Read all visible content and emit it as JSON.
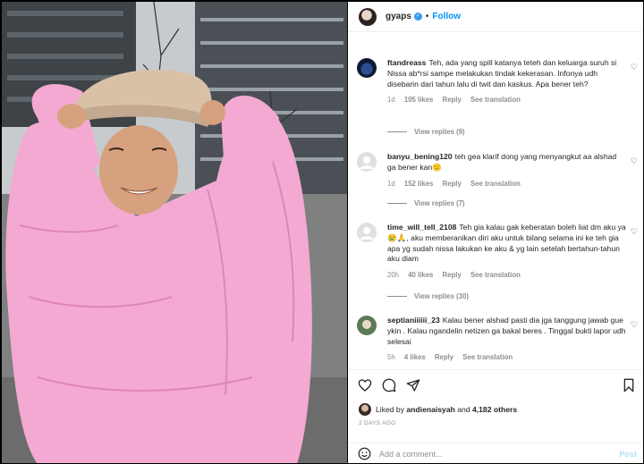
{
  "header": {
    "username": "gyaps",
    "separator": "•",
    "follow_label": "Follow"
  },
  "comments": [
    {
      "username": "ftandreass",
      "text": "Teh, ada yang spill katanya teteh dan keluarga suruh si Nissa ab*rsi sampe melakukan tindak kekerasan. Infonya udh disebarin dari tahun lalu di twit dan kaskus. Apa bener teh?",
      "time": "1d",
      "likes": "105 likes",
      "reply_label": "Reply",
      "translate_label": "See translation",
      "view_replies": "View replies (9)"
    },
    {
      "username": "banyu_bening120",
      "text": "teh gea klarif dong yang menyangkut aa alshad ga bener kan😕",
      "time": "1d",
      "likes": "152 likes",
      "reply_label": "Reply",
      "translate_label": "See translation",
      "view_replies": "View replies (7)"
    },
    {
      "username": "time_will_tell_2108",
      "text": "Teh gia kalau gak keberatan boleh liat dm aku ya 😢🙏, aku memberanikan diri aku untuk bilang selama ini ke teh gia apa yg sudah nissa lakukan ke aku & yg lain setelah bertahun-tahun aku diam",
      "time": "20h",
      "likes": "40 likes",
      "reply_label": "Reply",
      "translate_label": "See translation",
      "view_replies": "View replies (30)"
    },
    {
      "username": "septianiiiiii_23",
      "text": "Kalau bener alshad pasti dia jga tanggung jawab gue ykin . Kalau ngandelin netizen ga bakal beres . Tinggal bukti lapor udh selesai",
      "time": "5h",
      "likes": "4 likes",
      "reply_label": "Reply",
      "translate_label": "See translation"
    }
  ],
  "footer": {
    "liked_prefix": "Liked by",
    "liked_user": "andienaisyah",
    "liked_and": "and",
    "liked_others": "4,182 others",
    "date": "2 DAYS AGO",
    "comment_placeholder": "Add a comment...",
    "post_label": "Post"
  },
  "colors": {
    "accent": "#0095f6",
    "verified": "#3897f0",
    "muted": "#8e8e8e",
    "jacket": "#f2a6cf",
    "post_disabled": "#b2dffc"
  },
  "icons": {
    "like": "heart-icon",
    "comment": "comment-bubble-icon",
    "share": "paper-plane-icon",
    "save": "bookmark-icon",
    "emoji": "smiley-icon"
  }
}
